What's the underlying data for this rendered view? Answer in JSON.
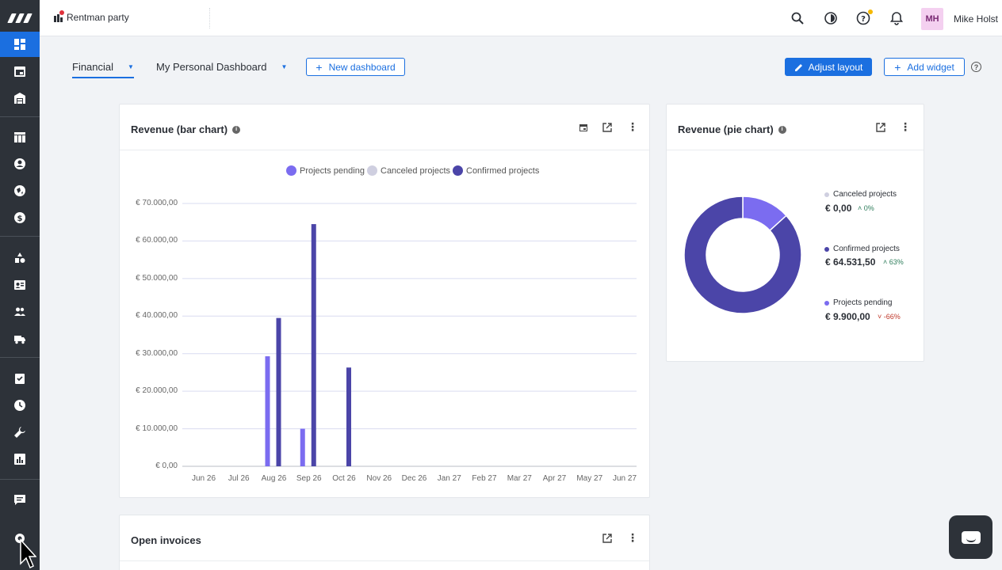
{
  "topbar": {
    "account_name": "Rentman party",
    "user_initials": "MH",
    "user_name": "Mike Holst"
  },
  "rail": {
    "icons": [
      "dashboard-icon",
      "calendar-icon",
      "warehouse-icon",
      "table-icon",
      "contact-icon",
      "globe-icon",
      "dollar-icon",
      "shapes-icon",
      "id-card-icon",
      "people-icon",
      "truck-icon",
      "checklist-icon",
      "clock-icon",
      "wrench-icon",
      "report-icon",
      "chat-icon",
      "settings-icon"
    ]
  },
  "dashboard_tabs": [
    {
      "label": "Financial",
      "active": true
    },
    {
      "label": "My Personal Dashboard",
      "active": false
    }
  ],
  "buttons": {
    "new_dashboard": "New dashboard",
    "adjust_layout": "Adjust layout",
    "add_widget": "Add widget",
    "help": "?"
  },
  "bar_widget": {
    "title": "Revenue (bar chart)"
  },
  "pie_widget": {
    "title": "Revenue (pie chart)",
    "items": [
      {
        "name": "Canceled projects",
        "value": "€ 0,00",
        "change": "0%",
        "direction": "up",
        "color": "#cfcfe0"
      },
      {
        "name": "Confirmed projects",
        "value": "€ 64.531,50",
        "change": "63%",
        "direction": "up",
        "color": "#4b45a8"
      },
      {
        "name": "Projects pending",
        "value": "€ 9.900,00",
        "change": "-66%",
        "direction": "down",
        "color": "#7b6cf0"
      }
    ]
  },
  "invoices_widget": {
    "title": "Open invoices"
  },
  "colors": {
    "accent": "#1b6fe0",
    "pending": "#7b6cf0",
    "canceled": "#cfcfe0",
    "confirmed": "#4b45a8",
    "positive": "#2e7d5b",
    "negative": "#c0392b"
  },
  "chart_data": [
    {
      "type": "bar",
      "title": "Revenue (bar chart)",
      "categories": [
        "Jun 26",
        "Jul 26",
        "Aug 26",
        "Sep 26",
        "Oct 26",
        "Nov 26",
        "Dec 26",
        "Jan 27",
        "Feb 27",
        "Mar 27",
        "Apr 27",
        "May 27",
        "Jun 27"
      ],
      "series": [
        {
          "name": "Projects pending",
          "color": "#7b6cf0",
          "values": [
            0,
            0,
            29300,
            10000,
            0,
            0,
            0,
            0,
            0,
            0,
            0,
            0,
            0
          ]
        },
        {
          "name": "Canceled projects",
          "color": "#cfcfe0",
          "values": [
            0,
            0,
            0,
            0,
            0,
            0,
            0,
            0,
            0,
            0,
            0,
            0,
            0
          ]
        },
        {
          "name": "Confirmed projects",
          "color": "#4b45a8",
          "values": [
            0,
            0,
            39500,
            64500,
            26300,
            0,
            0,
            0,
            0,
            0,
            0,
            0,
            0
          ]
        }
      ],
      "yticks": [
        "€ 70.000,00",
        "€ 60.000,00",
        "€ 50.000,00",
        "€ 40.000,00",
        "€ 30.000,00",
        "€ 20.000,00",
        "€ 10.000,00",
        "€ 0,00"
      ],
      "ylim": [
        0,
        70000
      ],
      "grid": true,
      "legend": "top-center"
    },
    {
      "type": "pie",
      "title": "Revenue (pie chart)",
      "labels": [
        "Canceled projects",
        "Confirmed projects",
        "Projects pending"
      ],
      "values": [
        0,
        64531.5,
        9900.0
      ],
      "colors": [
        "#cfcfe0",
        "#4b45a8",
        "#7b6cf0"
      ],
      "donut": true,
      "legend": "right"
    }
  ]
}
